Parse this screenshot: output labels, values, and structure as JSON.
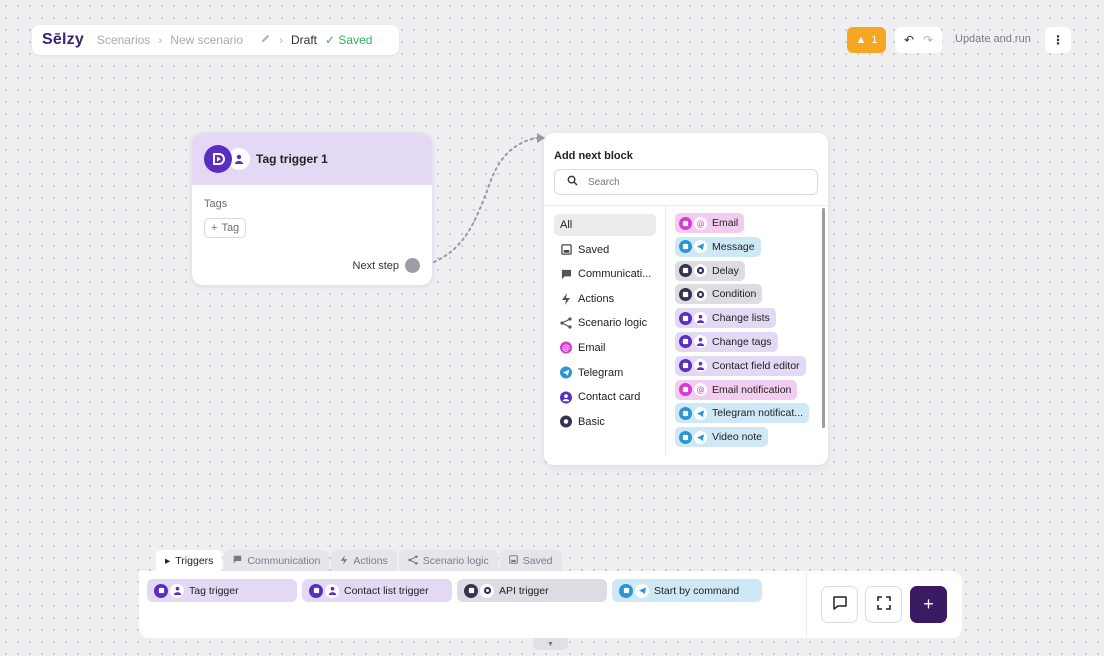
{
  "header": {
    "logo": "Sēlzy",
    "breadcrumb": [
      "Scenarios",
      "New scenario"
    ],
    "status": "Draft",
    "saved_label": "Saved",
    "warning_count": "1",
    "update_run_label": "Update and run"
  },
  "node": {
    "title": "Tag trigger 1",
    "tags_label": "Tags",
    "tag_button": "Tag",
    "next_step_label": "Next step"
  },
  "panel": {
    "title": "Add next block",
    "search_placeholder": "Search",
    "categories": [
      {
        "label": "All",
        "icon": "all"
      },
      {
        "label": "Saved",
        "icon": "save-icon"
      },
      {
        "label": "Communicati...",
        "icon": "chat-icon"
      },
      {
        "label": "Actions",
        "icon": "lightning-icon"
      },
      {
        "label": "Scenario logic",
        "icon": "branch-icon"
      },
      {
        "label": "Email",
        "icon": "at-icon"
      },
      {
        "label": "Telegram",
        "icon": "telegram-icon"
      },
      {
        "label": "Contact card",
        "icon": "person-icon"
      },
      {
        "label": "Basic",
        "icon": "circle-icon"
      }
    ],
    "blocks": [
      {
        "label": "Email",
        "bg": "#f3cdf0",
        "c1": "#d63ad1",
        "kind": "at"
      },
      {
        "label": "Message",
        "bg": "#cfe8f6",
        "c1": "#2a97d4",
        "kind": "tg"
      },
      {
        "label": "Delay",
        "bg": "#dcdce2",
        "c1": "#343452",
        "kind": "basic"
      },
      {
        "label": "Condition",
        "bg": "#dcdce2",
        "c1": "#343452",
        "kind": "basic"
      },
      {
        "label": "Change lists",
        "bg": "#e3d9f4",
        "c1": "#5a2fbf",
        "kind": "person"
      },
      {
        "label": "Change tags",
        "bg": "#e3d9f4",
        "c1": "#5a2fbf",
        "kind": "person"
      },
      {
        "label": "Contact field editor",
        "bg": "#e3d9f4",
        "c1": "#5a2fbf",
        "kind": "person"
      },
      {
        "label": "Email notification",
        "bg": "#f3cdf0",
        "c1": "#d63ad1",
        "kind": "at"
      },
      {
        "label": "Telegram notificat...",
        "bg": "#cfe8f6",
        "c1": "#2a97d4",
        "kind": "tg"
      },
      {
        "label": "Video note",
        "bg": "#cfe8f6",
        "c1": "#2a97d4",
        "kind": "tg"
      }
    ]
  },
  "palette": {
    "tabs": [
      "Triggers",
      "Communication",
      "Actions",
      "Scenario logic",
      "Saved"
    ],
    "items": [
      {
        "label": "Tag trigger",
        "bg": "#e3d9f4",
        "c1": "#5a2fbf",
        "kind": "person"
      },
      {
        "label": "Contact list trigger",
        "bg": "#e3d9f4",
        "c1": "#5a2fbf",
        "kind": "person"
      },
      {
        "label": "API trigger",
        "bg": "#dcdce2",
        "c1": "#343452",
        "kind": "basic"
      },
      {
        "label": "Start by command",
        "bg": "#cfe8f6",
        "c1": "#2a97d4",
        "kind": "tg"
      }
    ]
  }
}
